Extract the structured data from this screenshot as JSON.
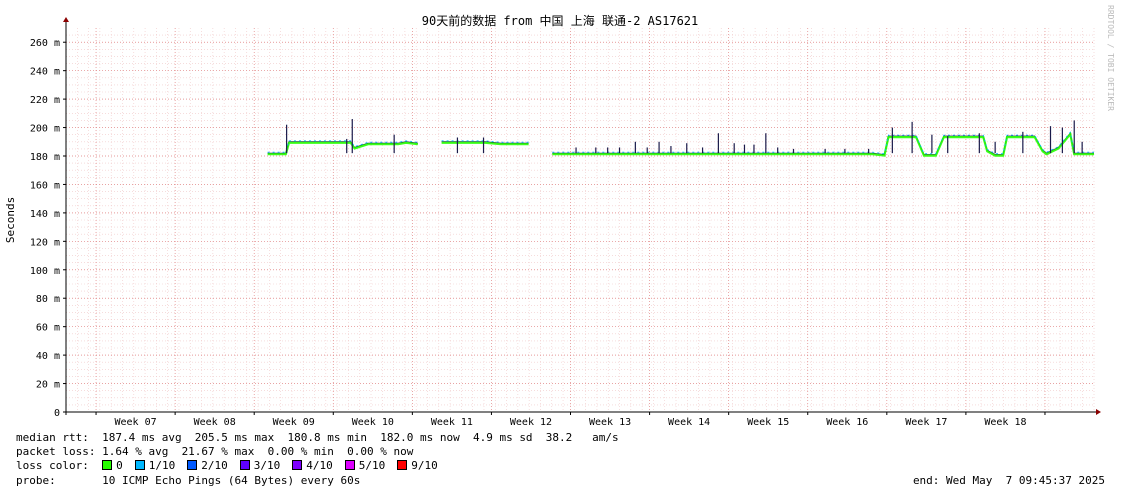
{
  "chart_data": {
    "type": "line",
    "title": "90天前的数据 from 中国 上海 联通-2 AS17621",
    "ylabel": "Seconds",
    "watermark": "RRDTOOL / TOBI OETIKER",
    "ylim": [
      0,
      270
    ],
    "yticks": [
      {
        "value": 0,
        "label": "0"
      },
      {
        "value": 20,
        "label": "20 m"
      },
      {
        "value": 40,
        "label": "40 m"
      },
      {
        "value": 60,
        "label": "60 m"
      },
      {
        "value": 80,
        "label": "80 m"
      },
      {
        "value": 100,
        "label": "100 m"
      },
      {
        "value": 120,
        "label": "120 m"
      },
      {
        "value": 140,
        "label": "140 m"
      },
      {
        "value": 160,
        "label": "160 m"
      },
      {
        "value": 180,
        "label": "180 m"
      },
      {
        "value": 200,
        "label": "200 m"
      },
      {
        "value": 220,
        "label": "220 m"
      },
      {
        "value": 240,
        "label": "240 m"
      },
      {
        "value": 260,
        "label": "260 m"
      }
    ],
    "xlim": [
      0,
      13
    ],
    "week_labels": [
      {
        "x": 0.88,
        "label": "Week 07"
      },
      {
        "x": 1.88,
        "label": "Week 08"
      },
      {
        "x": 2.88,
        "label": "Week 09"
      },
      {
        "x": 3.88,
        "label": "Week 10"
      },
      {
        "x": 4.88,
        "label": "Week 11"
      },
      {
        "x": 5.88,
        "label": "Week 12"
      },
      {
        "x": 6.88,
        "label": "Week 13"
      },
      {
        "x": 7.88,
        "label": "Week 14"
      },
      {
        "x": 8.88,
        "label": "Week 15"
      },
      {
        "x": 9.88,
        "label": "Week 16"
      },
      {
        "x": 10.88,
        "label": "Week 17"
      },
      {
        "x": 11.88,
        "label": "Week 18"
      }
    ],
    "week_boundaries": [
      0.38,
      1.38,
      2.38,
      3.38,
      4.38,
      5.38,
      6.38,
      7.38,
      8.38,
      9.38,
      10.38,
      11.38,
      12.38
    ],
    "median_series": {
      "name": "median rtt",
      "segments": [
        [
          [
            2.55,
            182
          ],
          [
            2.78,
            182
          ],
          [
            2.82,
            190
          ],
          [
            3.15,
            190
          ],
          [
            3.6,
            190
          ],
          [
            3.65,
            186
          ],
          [
            3.82,
            189
          ],
          [
            4.2,
            189
          ],
          [
            4.3,
            190
          ],
          [
            4.45,
            189
          ]
        ],
        [
          [
            4.75,
            190
          ],
          [
            5.3,
            190
          ],
          [
            5.5,
            189
          ],
          [
            5.85,
            189
          ]
        ],
        [
          [
            6.15,
            182
          ],
          [
            7.0,
            182
          ],
          [
            7.4,
            182
          ],
          [
            8.0,
            182
          ],
          [
            8.5,
            182
          ],
          [
            9.5,
            182
          ],
          [
            10.2,
            182
          ],
          [
            10.35,
            181
          ],
          [
            10.4,
            194
          ],
          [
            10.75,
            194
          ],
          [
            10.85,
            181
          ],
          [
            11.0,
            181
          ],
          [
            11.1,
            194
          ],
          [
            11.6,
            194
          ],
          [
            11.65,
            184
          ],
          [
            11.75,
            181
          ],
          [
            11.85,
            181
          ],
          [
            11.9,
            194
          ],
          [
            12.25,
            194
          ],
          [
            12.35,
            184
          ],
          [
            12.4,
            182
          ],
          [
            12.55,
            186
          ],
          [
            12.7,
            196
          ],
          [
            12.75,
            182
          ],
          [
            13.0,
            182
          ]
        ]
      ]
    },
    "spikes": [
      [
        2.79,
        202
      ],
      [
        3.62,
        206
      ],
      [
        3.55,
        192
      ],
      [
        4.15,
        195
      ],
      [
        4.95,
        193
      ],
      [
        5.28,
        193
      ],
      [
        6.45,
        186
      ],
      [
        6.7,
        186
      ],
      [
        6.85,
        186
      ],
      [
        7.0,
        186
      ],
      [
        7.2,
        190
      ],
      [
        7.35,
        186
      ],
      [
        7.5,
        190
      ],
      [
        7.65,
        187
      ],
      [
        7.85,
        189
      ],
      [
        8.05,
        186
      ],
      [
        8.25,
        196
      ],
      [
        8.45,
        189
      ],
      [
        8.58,
        188
      ],
      [
        8.7,
        188
      ],
      [
        8.85,
        196
      ],
      [
        9.0,
        186
      ],
      [
        9.2,
        185
      ],
      [
        9.6,
        185
      ],
      [
        9.85,
        185
      ],
      [
        10.15,
        185
      ],
      [
        10.45,
        200
      ],
      [
        10.7,
        204
      ],
      [
        10.95,
        195
      ],
      [
        11.15,
        194
      ],
      [
        11.55,
        196
      ],
      [
        11.75,
        190
      ],
      [
        12.1,
        197
      ],
      [
        12.45,
        201
      ],
      [
        12.6,
        200
      ],
      [
        12.75,
        205
      ],
      [
        12.85,
        190
      ]
    ]
  },
  "stats": {
    "median_rtt": "median rtt:  187.4 ms avg  205.5 ms max  180.8 ms min  182.0 ms now  4.9 ms sd  38.2   am/s",
    "packet_loss": "packet loss: 1.64 % avg  21.67 % max  0.00 % min  0.00 % now",
    "loss_color_label": "loss color:",
    "loss_legend": [
      {
        "label": "0",
        "color": "#26ff00"
      },
      {
        "label": "1/10",
        "color": "#00b8ff"
      },
      {
        "label": "2/10",
        "color": "#0059ff"
      },
      {
        "label": "3/10",
        "color": "#5e00ff"
      },
      {
        "label": "4/10",
        "color": "#7e00ff"
      },
      {
        "label": "5/10",
        "color": "#dd00ff"
      },
      {
        "label": "9/10",
        "color": "#ff0000"
      }
    ],
    "probe": "probe:       10 ICMP Echo Pings (64 Bytes) every 60s",
    "end": "end: Wed May  7 09:45:37 2025"
  }
}
